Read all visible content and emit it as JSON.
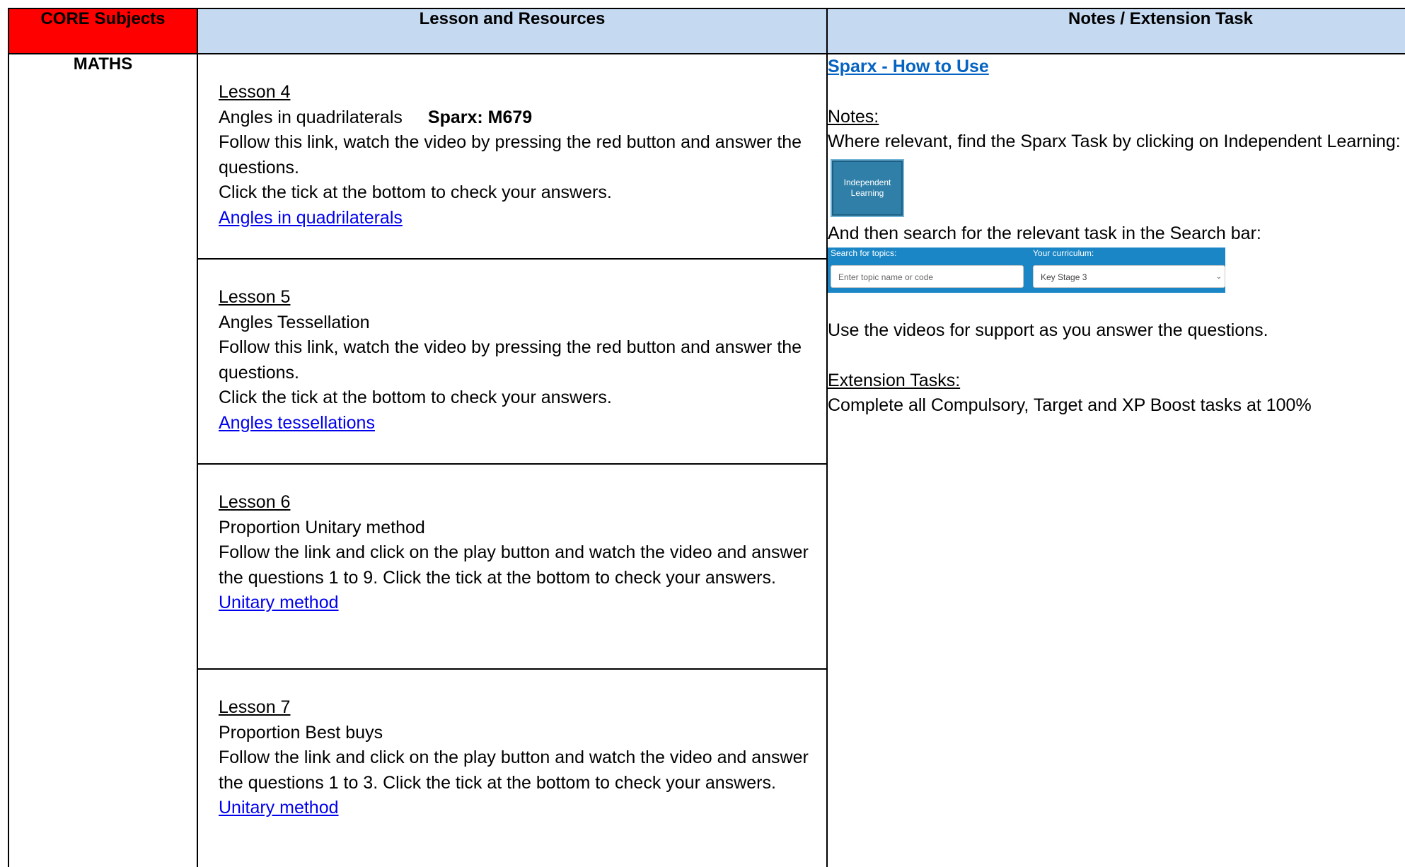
{
  "header": {
    "core": "CORE Subjects",
    "lesson": "Lesson and Resources",
    "notes": "Notes / Extension Task"
  },
  "subject": "MATHS",
  "lessons": [
    {
      "title": "Lesson 4",
      "topic": "Angles in quadrilaterals",
      "code": "Sparx: M679",
      "instruction1": "Follow this link, watch the video by pressing the red button and answer the questions.",
      "instruction2": "Click the tick at the bottom to check your answers.",
      "link": "Angles in quadrilaterals"
    },
    {
      "title": "Lesson 5",
      "topic": "Angles Tessellation",
      "instruction1": "Follow this link, watch the video by pressing the red button and answer the  questions.",
      "instruction2": "Click the tick at the bottom to check your answers.",
      "link": "Angles tessellations"
    },
    {
      "title": "Lesson 6",
      "topic": "Proportion Unitary method",
      "instruction1": "Follow the link and click on the play button and watch the video and answer the questions 1 to 9. Click the tick at the bottom to check your answers.",
      "link": "Unitary method"
    },
    {
      "title": "Lesson 7",
      "topic": "Proportion Best buys",
      "instruction1": "Follow the link and click on the play button and watch the video and answer the questions 1 to 3. Click the tick at the bottom to check your answers.",
      "link": "Unitary method"
    }
  ],
  "notes": {
    "sparx_link": "Sparx - How to Use",
    "notes_heading": "Notes:",
    "notes_text": "Where relevant, find the Sparx Task by clicking on Independent Learning:",
    "il_button_line1": "Independent",
    "il_button_line2": "Learning",
    "search_text": "And then search for the relevant task in the Search bar:",
    "search_label": "Search for topics:",
    "search_placeholder": "Enter topic name or code",
    "curriculum_label": "Your curriculum:",
    "curriculum_value": "Key Stage 3",
    "videos_text": "Use the videos for support as you answer the questions.",
    "extension_heading": "Extension Tasks:",
    "extension_text": "Complete all Compulsory, Target and XP Boost tasks at 100%"
  }
}
